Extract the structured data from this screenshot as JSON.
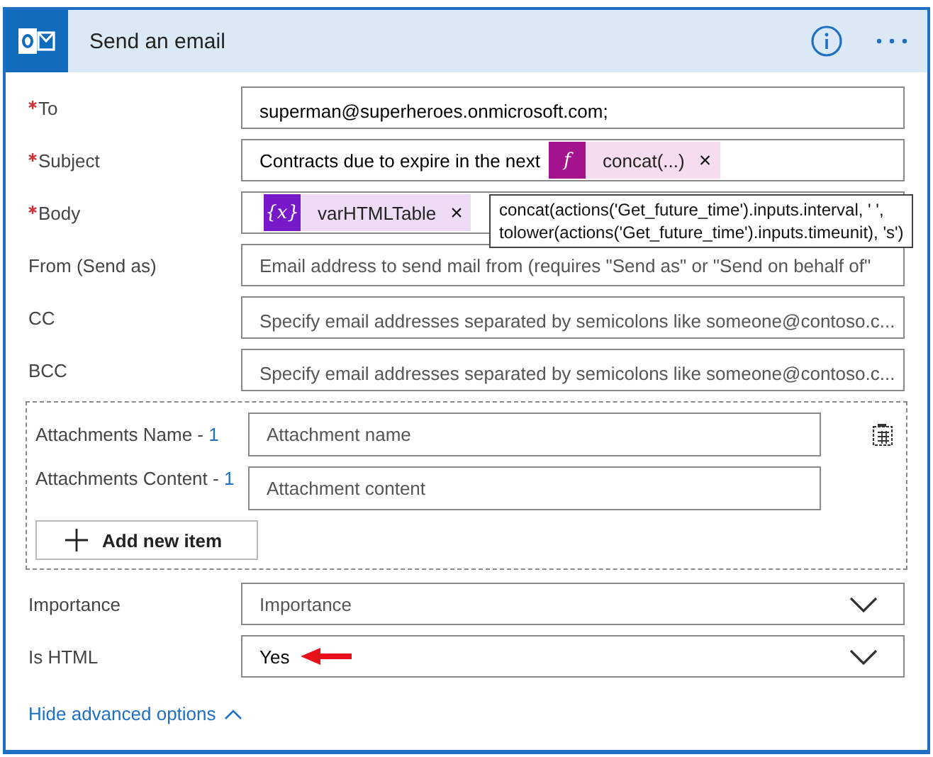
{
  "header": {
    "title": "Send an email"
  },
  "fields": [
    {
      "kind": "text",
      "label": "To",
      "required": true,
      "value": "superman@superheroes.onmicrosoft.com;"
    },
    {
      "kind": "tokens",
      "label": "Subject",
      "required": true,
      "value": "Contracts due to expire in the next",
      "tokens": [
        {
          "kind": "expression",
          "icon": "f",
          "label": "concat(...)",
          "remove": "×"
        }
      ]
    },
    {
      "kind": "tokens",
      "label": "Body",
      "required": true,
      "tokens": [
        {
          "kind": "variable",
          "icon": "{x}",
          "label": "varHTMLTable",
          "remove": "×"
        }
      ]
    },
    {
      "kind": "text",
      "label": "From (Send as)",
      "required": false,
      "placeholder": "Email address to send mail from (requires \"Send as\" or \"Send on behalf of\""
    },
    {
      "kind": "text",
      "label": "CC",
      "required": false,
      "placeholder": "Specify email addresses separated by semicolons like someone@contoso.c..."
    },
    {
      "kind": "text",
      "label": "BCC",
      "required": false,
      "placeholder": "Specify email addresses separated by semicolons like someone@contoso.c..."
    }
  ],
  "tooltip": {
    "lines": [
      "concat(actions('Get_future_time').inputs.interval, ' ',",
      "tolower(actions('Get_future_time').inputs.timeunit), 's')"
    ]
  },
  "attachments": {
    "items": [
      {
        "label": "Attachments Name -",
        "index": "1",
        "placeholder": "Attachment name"
      },
      {
        "label": "Attachments Content -",
        "index": "1",
        "placeholder": "Attachment content"
      }
    ],
    "add_button": "Add new item"
  },
  "options": [
    {
      "kind": "dropdown",
      "label": "Importance",
      "placeholder": "Importance"
    },
    {
      "kind": "dropdown",
      "label": "Is HTML",
      "value": "Yes",
      "annotated": true
    }
  ],
  "footer_link": "Hide advanced options"
}
